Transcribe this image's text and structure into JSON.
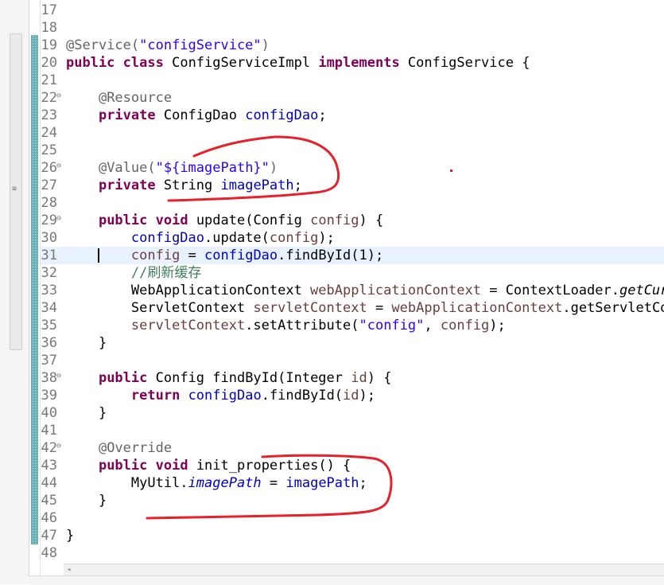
{
  "editor": {
    "lines": [
      {
        "n": "17",
        "fold": "",
        "current": false,
        "tokens": []
      },
      {
        "n": "18",
        "fold": "",
        "current": false,
        "tokens": []
      },
      {
        "n": "19",
        "fold": "",
        "current": false,
        "tokens": [
          {
            "c": "an",
            "t": "@Service("
          },
          {
            "c": "str",
            "t": "\"configService\""
          },
          {
            "c": "an",
            "t": ")"
          }
        ]
      },
      {
        "n": "20",
        "fold": "",
        "current": false,
        "tokens": [
          {
            "c": "kw",
            "t": "public"
          },
          {
            "c": "",
            "t": " "
          },
          {
            "c": "kw",
            "t": "class"
          },
          {
            "c": "",
            "t": " ConfigServiceImpl "
          },
          {
            "c": "kw",
            "t": "implements"
          },
          {
            "c": "",
            "t": " ConfigService {"
          }
        ]
      },
      {
        "n": "21",
        "fold": "",
        "current": false,
        "tokens": []
      },
      {
        "n": "22",
        "fold": "minus",
        "current": false,
        "tokens": [
          {
            "c": "",
            "t": "    "
          },
          {
            "c": "an",
            "t": "@Resource"
          }
        ]
      },
      {
        "n": "23",
        "fold": "",
        "current": false,
        "tokens": [
          {
            "c": "",
            "t": "    "
          },
          {
            "c": "kw",
            "t": "private"
          },
          {
            "c": "",
            "t": " ConfigDao "
          },
          {
            "c": "fld",
            "t": "configDao"
          },
          {
            "c": "",
            "t": ";"
          }
        ]
      },
      {
        "n": "24",
        "fold": "",
        "current": false,
        "tokens": []
      },
      {
        "n": "25",
        "fold": "",
        "current": false,
        "tokens": []
      },
      {
        "n": "26",
        "fold": "minus",
        "current": false,
        "tokens": [
          {
            "c": "",
            "t": "    "
          },
          {
            "c": "an",
            "t": "@Value("
          },
          {
            "c": "str",
            "t": "\"${imagePath}\""
          },
          {
            "c": "an",
            "t": ")"
          }
        ]
      },
      {
        "n": "27",
        "fold": "",
        "current": false,
        "tokens": [
          {
            "c": "",
            "t": "    "
          },
          {
            "c": "kw",
            "t": "private"
          },
          {
            "c": "",
            "t": " String "
          },
          {
            "c": "fld",
            "t": "imagePath"
          },
          {
            "c": "",
            "t": ";"
          }
        ]
      },
      {
        "n": "28",
        "fold": "",
        "current": false,
        "tokens": []
      },
      {
        "n": "29",
        "fold": "minus",
        "current": false,
        "tokens": [
          {
            "c": "",
            "t": "    "
          },
          {
            "c": "kw",
            "t": "public"
          },
          {
            "c": "",
            "t": " "
          },
          {
            "c": "kw",
            "t": "void"
          },
          {
            "c": "",
            "t": " update(Config "
          },
          {
            "c": "loc",
            "t": "config"
          },
          {
            "c": "",
            "t": ") {"
          }
        ]
      },
      {
        "n": "30",
        "fold": "",
        "current": false,
        "tokens": [
          {
            "c": "",
            "t": "        "
          },
          {
            "c": "fld",
            "t": "configDao"
          },
          {
            "c": "",
            "t": ".update("
          },
          {
            "c": "loc",
            "t": "config"
          },
          {
            "c": "",
            "t": ");"
          }
        ]
      },
      {
        "n": "31",
        "fold": "",
        "current": true,
        "tokens": [
          {
            "c": "",
            "t": "        "
          },
          {
            "c": "loc",
            "t": "config"
          },
          {
            "c": "",
            "t": " = "
          },
          {
            "c": "fld",
            "t": "configDao"
          },
          {
            "c": "",
            "t": ".findById(1);"
          }
        ]
      },
      {
        "n": "32",
        "fold": "",
        "current": false,
        "tokens": [
          {
            "c": "",
            "t": "        "
          },
          {
            "c": "cmt",
            "t": "//刷新缓存"
          }
        ]
      },
      {
        "n": "33",
        "fold": "",
        "current": false,
        "tokens": [
          {
            "c": "",
            "t": "        WebApplicationContext "
          },
          {
            "c": "loc",
            "t": "webApplicationContext"
          },
          {
            "c": "",
            "t": " = ContextLoader."
          },
          {
            "c": "it",
            "t": "getCurre"
          }
        ]
      },
      {
        "n": "34",
        "fold": "",
        "current": false,
        "tokens": [
          {
            "c": "",
            "t": "        ServletContext "
          },
          {
            "c": "loc",
            "t": "servletContext"
          },
          {
            "c": "",
            "t": " = "
          },
          {
            "c": "loc",
            "t": "webApplicationContext"
          },
          {
            "c": "",
            "t": ".getServletCont"
          }
        ]
      },
      {
        "n": "35",
        "fold": "",
        "current": false,
        "tokens": [
          {
            "c": "",
            "t": "        "
          },
          {
            "c": "loc",
            "t": "servletContext"
          },
          {
            "c": "",
            "t": ".setAttribute("
          },
          {
            "c": "str",
            "t": "\"config\""
          },
          {
            "c": "",
            "t": ", "
          },
          {
            "c": "loc",
            "t": "config"
          },
          {
            "c": "",
            "t": ");"
          }
        ]
      },
      {
        "n": "36",
        "fold": "",
        "current": false,
        "tokens": [
          {
            "c": "",
            "t": "    }"
          }
        ]
      },
      {
        "n": "37",
        "fold": "",
        "current": false,
        "tokens": []
      },
      {
        "n": "38",
        "fold": "minus",
        "current": false,
        "tokens": [
          {
            "c": "",
            "t": "    "
          },
          {
            "c": "kw",
            "t": "public"
          },
          {
            "c": "",
            "t": " Config findById(Integer "
          },
          {
            "c": "loc",
            "t": "id"
          },
          {
            "c": "",
            "t": ") {"
          }
        ]
      },
      {
        "n": "39",
        "fold": "",
        "current": false,
        "tokens": [
          {
            "c": "",
            "t": "        "
          },
          {
            "c": "kw",
            "t": "return"
          },
          {
            "c": "",
            "t": " "
          },
          {
            "c": "fld",
            "t": "configDao"
          },
          {
            "c": "",
            "t": ".findById("
          },
          {
            "c": "loc",
            "t": "id"
          },
          {
            "c": "",
            "t": ");"
          }
        ]
      },
      {
        "n": "40",
        "fold": "",
        "current": false,
        "tokens": [
          {
            "c": "",
            "t": "    }"
          }
        ]
      },
      {
        "n": "41",
        "fold": "",
        "current": false,
        "tokens": []
      },
      {
        "n": "42",
        "fold": "minus",
        "current": false,
        "tokens": [
          {
            "c": "",
            "t": "    "
          },
          {
            "c": "an",
            "t": "@Override"
          }
        ]
      },
      {
        "n": "43",
        "fold": "",
        "current": false,
        "tokens": [
          {
            "c": "",
            "t": "    "
          },
          {
            "c": "kw",
            "t": "public"
          },
          {
            "c": "",
            "t": " "
          },
          {
            "c": "kw",
            "t": "void"
          },
          {
            "c": "",
            "t": " init_properties() {"
          }
        ]
      },
      {
        "n": "44",
        "fold": "",
        "current": false,
        "tokens": [
          {
            "c": "",
            "t": "        MyUtil."
          },
          {
            "c": "fld it",
            "t": "imagePath"
          },
          {
            "c": "",
            "t": " = "
          },
          {
            "c": "fld",
            "t": "imagePath"
          },
          {
            "c": "",
            "t": ";"
          }
        ]
      },
      {
        "n": "45",
        "fold": "",
        "current": false,
        "tokens": [
          {
            "c": "",
            "t": "    }"
          }
        ]
      },
      {
        "n": "46",
        "fold": "",
        "current": false,
        "tokens": []
      },
      {
        "n": "47",
        "fold": "",
        "current": false,
        "tokens": [
          {
            "c": "",
            "t": "}"
          }
        ]
      },
      {
        "n": "48",
        "fold": "",
        "current": false,
        "tokens": []
      }
    ]
  },
  "icons": {
    "fold_minus": "⊖",
    "override_marker": "◭",
    "scroll_left": "◂",
    "grip": "≡"
  },
  "colors": {
    "keyword": "#7f0055",
    "annotation": "#646464",
    "string": "#2a00ff",
    "field": "#0000c0",
    "local_variable": "#6a3e3e",
    "comment": "#3f7f5f",
    "current_line": "#e8f2fe",
    "ink_annotation": "#e8202a"
  }
}
